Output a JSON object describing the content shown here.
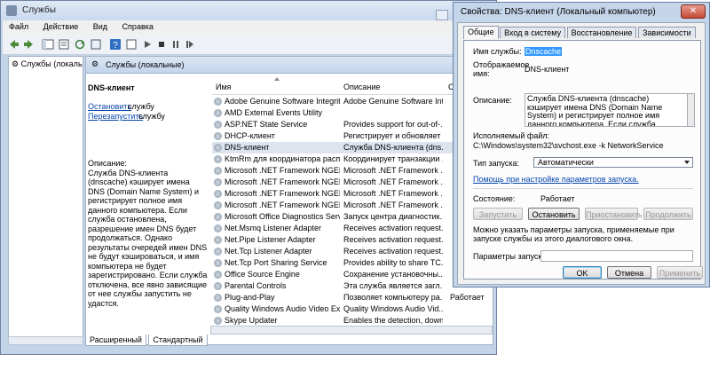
{
  "services_window": {
    "title": "Службы",
    "menu": [
      "Файл",
      "Действие",
      "Вид",
      "Справка"
    ],
    "tree_item": "Службы (локалы",
    "panel_header": "Службы (локальные)",
    "tabs": [
      "Расширенный",
      "Стандартный"
    ]
  },
  "description_pane": {
    "service_name": "DNS-клиент",
    "stop_link": "Остановить",
    "stop_suffix": "службу",
    "restart_link": "Перезапустить",
    "restart_suffix": "службу",
    "description": "Описание:\nСлужба DNS-клиента (dnscache) кэширует имена DNS (Domain Name System) и регистрирует полное имя данного компьютера. Если служба остановлена, разрешение имен DNS будет продолжаться. Однако результаты очередей имен DNS не будут кэшироваться, и имя компьютера не будет зарегистрировано. Если служба отключена, все явно зависящие от нее службы запустить не удастся."
  },
  "service_list": {
    "columns": [
      "Имя",
      "Описание",
      "Со"
    ],
    "rows": [
      {
        "name": "Adobe Genuine Software Integrity ...",
        "desc": "Adobe Genuine Software Int...",
        "state": "",
        "selected": false
      },
      {
        "name": "AMD External Events Utility",
        "desc": "",
        "state": "",
        "selected": false
      },
      {
        "name": "ASP.NET State Service",
        "desc": "Provides support for out-of-...",
        "state": "",
        "selected": false
      },
      {
        "name": "DHCP-клиент",
        "desc": "Регистрирует и обновляет ...",
        "state": "",
        "selected": false
      },
      {
        "name": "DNS-клиент",
        "desc": "Служба DNS-клиента (dns...",
        "state": "",
        "selected": true
      },
      {
        "name": "KtmRm для координатора распре...",
        "desc": "Координирует транзакции ...",
        "state": "",
        "selected": false
      },
      {
        "name": "Microsoft .NET Framework NGEN v...",
        "desc": "Microsoft .NET Framework ...",
        "state": "",
        "selected": false
      },
      {
        "name": "Microsoft .NET Framework NGEN v...",
        "desc": "Microsoft .NET Framework ...",
        "state": "",
        "selected": false
      },
      {
        "name": "Microsoft .NET Framework NGEN v...",
        "desc": "Microsoft .NET Framework ...",
        "state": "",
        "selected": false
      },
      {
        "name": "Microsoft .NET Framework NGEN v...",
        "desc": "Microsoft .NET Framework ...",
        "state": "",
        "selected": false
      },
      {
        "name": "Microsoft Office Diagnostics Service",
        "desc": "Запуск центра диагностик...",
        "state": "",
        "selected": false
      },
      {
        "name": "Net.Msmq Listener Adapter",
        "desc": "Receives activation request...",
        "state": "",
        "selected": false
      },
      {
        "name": "Net.Pipe Listener Adapter",
        "desc": "Receives activation request...",
        "state": "",
        "selected": false
      },
      {
        "name": "Net.Tcp Listener Adapter",
        "desc": "Receives activation request...",
        "state": "",
        "selected": false
      },
      {
        "name": "Net.Tcp Port Sharing Service",
        "desc": "Provides ability to share TC...",
        "state": "",
        "selected": false
      },
      {
        "name": "Office Source Engine",
        "desc": "Сохранение установочны...",
        "state": "",
        "selected": false
      },
      {
        "name": "Parental Controls",
        "desc": "Эта служба является загл...",
        "state": "",
        "selected": false
      },
      {
        "name": "Plug-and-Play",
        "desc": "Позволяет компьютеру ра...",
        "state": "Работает",
        "selected": false
      },
      {
        "name": "Quality Windows Audio Video Expe...",
        "desc": "Quality Windows Audio Vid...",
        "state": "",
        "selected": false
      },
      {
        "name": "Skype Updater",
        "desc": "Enables the detection, down...",
        "state": "",
        "selected": false
      }
    ]
  },
  "dialog": {
    "title": "Свойства: DNS-клиент (Локальный компьютер)",
    "close_glyph": "✕",
    "tabs": [
      "Общие",
      "Вход в систему",
      "Восстановление",
      "Зависимости"
    ],
    "service_name_label": "Имя службы:",
    "service_name_value": "Dnscache",
    "display_name_label": "Отображаемое имя:",
    "display_name_value": "DNS-клиент",
    "description_label": "Описание:",
    "description_value": "Служба DNS-клиента (dnscache) кэширует имена DNS (Domain Name System) и регистрирует полное имя данного компьютера. Если служба остановлена, разрешение имен",
    "exec_label": "Исполняемый файл:",
    "exec_value": "C:\\Windows\\system32\\svchost.exe -k NetworkService",
    "startup_label": "Тип запуска:",
    "startup_value": "Автоматически",
    "help_link": "Помощь при настройке параметров запуска.",
    "state_label": "Состояние:",
    "state_value": "Работает",
    "btn_start": "Запустить",
    "btn_stop": "Остановить",
    "btn_pause": "Приостановить",
    "btn_continue": "Продолжить",
    "params_hint": "Можно указать параметры запуска, применяемые при запуске службы из этого диалогового окна.",
    "params_label": "Параметры запуска:",
    "params_value": "",
    "btn_ok": "OK",
    "btn_cancel": "Отмена",
    "btn_apply": "Применить"
  },
  "colors": {
    "accent_blue": "#3399ff",
    "link_blue": "#0645ad",
    "close_red": "#c44a36"
  }
}
